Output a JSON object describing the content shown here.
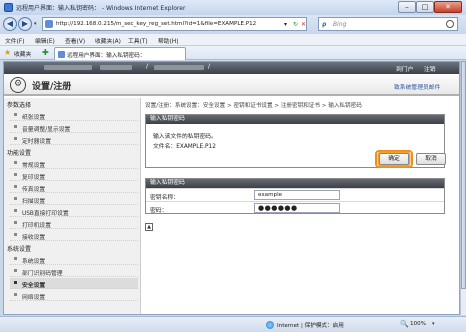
{
  "window": {
    "title": "远程用户界面：输入私钥密码：",
    "title_suffix": "- Windows Internet Explorer",
    "min_glyph": "–",
    "max_glyph": "□",
    "close_glyph": "✕"
  },
  "address_bar": {
    "url": "http://192.168.0.215/m_sec_key_reg_set.html?id=1&file=EXAMPLE.P12",
    "search_placeholder": "Bing"
  },
  "menu": [
    "文件(F)",
    "编辑(E)",
    "查看(V)",
    "收藏夹(A)",
    "工具(T)",
    "帮助(H)"
  ],
  "favorites": {
    "label": "收藏夹",
    "tab_title": "远程用户界面：输入私钥密码："
  },
  "remote_ui": {
    "top_separator": "/",
    "portal_link": "到门户",
    "logout_link": "注销",
    "heading": "设置/注册",
    "admin_email": "致系统管理员邮件"
  },
  "sidebar": {
    "sections": [
      {
        "title": "参数选择",
        "items": [
          "纸张设置",
          "音量调整/显示设置",
          "定时器设置"
        ]
      },
      {
        "title": "功能设置",
        "items": [
          "常规设置",
          "复印设置",
          "传真设置",
          "扫描设置",
          "USB直接打印设置",
          "打印机设置",
          "接收设置"
        ]
      },
      {
        "title": "系统设置",
        "items": [
          "系统设置",
          "部门识别码管理",
          "安全设置",
          "网络设置"
        ]
      }
    ],
    "active_item": "安全设置"
  },
  "breadcrumb": "设置/注册：系统设置：安全设置 > 密钥和证书设置 > 注册密钥和证书 > 输入私钥密码",
  "dialog": {
    "header": "输入私钥密码",
    "message": "输入该文件的私钥密码。",
    "file_label": "文件名：",
    "file_name": "EXAMPLE.P12",
    "ok_label": "确定",
    "cancel_label": "取消"
  },
  "key_form": {
    "header": "输入私钥密码",
    "key_name_label": "密钥名称：",
    "key_name_value": "example",
    "password_label": "密码：",
    "password_value": "●●●●●●"
  },
  "statusbar": {
    "zone": "Internet | 保护模式：启用",
    "zoom": "100%"
  }
}
